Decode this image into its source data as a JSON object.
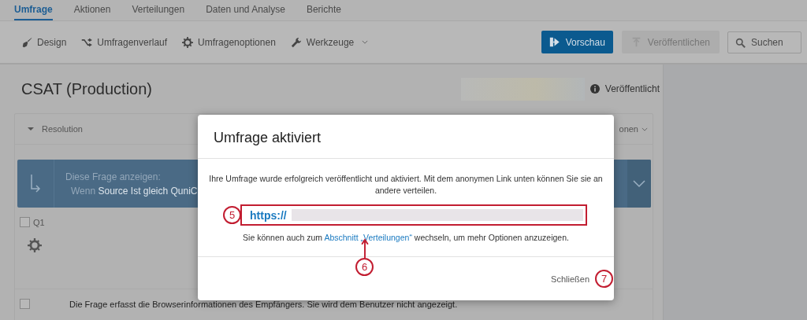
{
  "tabs": [
    {
      "label": "Umfrage",
      "selected": true
    },
    {
      "label": "Aktionen",
      "selected": false
    },
    {
      "label": "Verteilungen",
      "selected": false
    },
    {
      "label": "Daten und Analyse",
      "selected": false
    },
    {
      "label": "Berichte",
      "selected": false
    }
  ],
  "tools": [
    {
      "label": "Design",
      "dropdown": false
    },
    {
      "label": "Umfragenverlauf",
      "dropdown": false
    },
    {
      "label": "Umfragenoptionen",
      "dropdown": false
    },
    {
      "label": "Werkzeuge",
      "dropdown": true
    }
  ],
  "actions": [
    {
      "label": "Vorschau",
      "kind": "primary"
    },
    {
      "label": "Veröffentlichen",
      "kind": "disabled"
    }
  ],
  "search": {
    "placeholder": "Suchen"
  },
  "survey": {
    "title": "CSAT (Production)",
    "status": "Veröffentlicht"
  },
  "block": {
    "name": "Resolution",
    "expanded": true,
    "menu_label": "onen",
    "logic": {
      "heading": "Diese Frage anzeigen:",
      "prefix": "Wenn",
      "condition": "Source Ist gleich QuniC"
    },
    "question": {
      "label": "Q1",
      "checked": false
    },
    "note_row": {
      "checked": false,
      "text": "Die Frage erfasst die Browserinformationen des Empfängers. Sie wird dem Benutzer nicht angezeigt."
    }
  },
  "dialog": {
    "title": "Umfrage aktiviert",
    "message": "Ihre Umfrage wurde erfolgreich veröffentlicht und aktiviert. Mit dem anonymen Link unten können Sie sie an andere verteilen.",
    "link": "https://",
    "hint": {
      "before": "Sie können auch zum ",
      "link": "Abschnitt „Verteilungen“",
      "after": " wechseln, um mehr Optionen anzuzeigen."
    },
    "close": "Schließen"
  },
  "callouts": [
    "5",
    "6",
    "7"
  ]
}
